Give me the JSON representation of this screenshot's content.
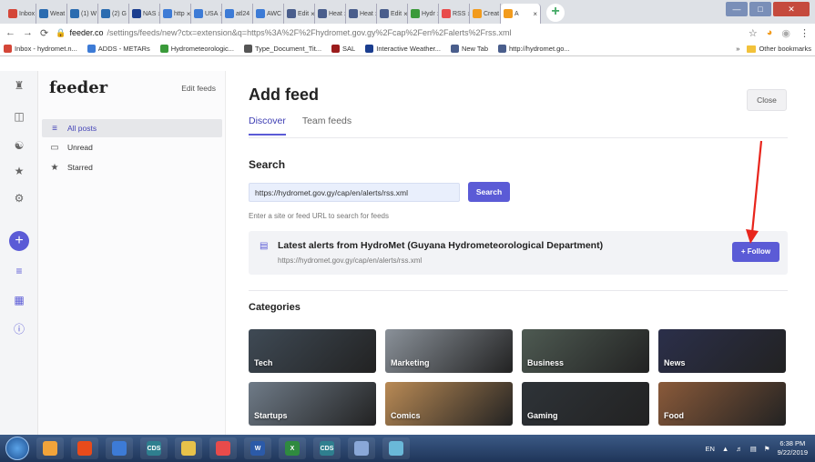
{
  "browser": {
    "tabs": [
      {
        "label": "Inbox",
        "color": "#d44638"
      },
      {
        "label": "Weat",
        "color": "#2b6cb0"
      },
      {
        "label": "(1) W",
        "color": "#2b6cb0"
      },
      {
        "label": "(2) G",
        "color": "#2b6cb0"
      },
      {
        "label": "NAS",
        "color": "#1a3d8f"
      },
      {
        "label": "http",
        "color": "#3d7bd6"
      },
      {
        "label": "USA",
        "color": "#3d7bd6"
      },
      {
        "label": "atl24",
        "color": "#3d7bd6"
      },
      {
        "label": "AWC",
        "color": "#3d7bd6"
      },
      {
        "label": "Edit",
        "color": "#4a5e8c"
      },
      {
        "label": "Heat",
        "color": "#4a5e8c"
      },
      {
        "label": "Heat",
        "color": "#4a5e8c"
      },
      {
        "label": "Edit",
        "color": "#4a5e8c"
      },
      {
        "label": "Hydr",
        "color": "#3a9a3a"
      },
      {
        "label": "RSS",
        "color": "#e84b4b"
      },
      {
        "label": "Creat",
        "color": "#f29b1d"
      },
      {
        "label": "A",
        "color": "#f29b1d"
      }
    ],
    "new_tab_symbol": "+",
    "url_host": "feeder.co",
    "url_rest": "/settings/feeds/new?ctx=extension&q=https%3A%2F%2Fhydromet.gov.gy%2Fcap%2Fen%2Falerts%2Frss.xml",
    "bookmarks": [
      {
        "label": "Inbox - hydromet.n...",
        "color": "#d44638"
      },
      {
        "label": "ADDS - METARs",
        "color": "#3d7bd6"
      },
      {
        "label": "Hydrometeorologic...",
        "color": "#3a9a3a"
      },
      {
        "label": "Type_Document_Tit...",
        "color": "#555555"
      },
      {
        "label": "SAL",
        "color": "#9b1c1c"
      },
      {
        "label": "Interactive Weather...",
        "color": "#1a3d8f"
      },
      {
        "label": "New Tab",
        "color": "#4a5e8c"
      },
      {
        "label": "http://hydromet.go...",
        "color": "#4a5e8c"
      }
    ],
    "overflow_symbol": "»",
    "other_bookmarks": "Other bookmarks"
  },
  "sidebar": {
    "logo": "feeder",
    "edit_feeds": "Edit feeds",
    "items": [
      {
        "label": "All posts",
        "icon": "list-icon"
      },
      {
        "label": "Unread",
        "icon": "inbox-icon"
      },
      {
        "label": "Starred",
        "icon": "star-icon"
      }
    ]
  },
  "main": {
    "title": "Add feed",
    "close_label": "Close",
    "tabs": [
      "Discover",
      "Team feeds"
    ],
    "search_heading": "Search",
    "search_value": "https://hydromet.gov.gy/cap/en/alerts/rss.xml",
    "search_button": "Search",
    "search_hint": "Enter a site or feed URL to search for feeds",
    "result": {
      "title": "Latest alerts from HydroMet (Guyana Hydrometeorological Department)",
      "url": "https://hydromet.gov.gy/cap/en/alerts/rss.xml",
      "follow_label": "+ Follow"
    },
    "categories_heading": "Categories",
    "categories": [
      {
        "label": "Tech",
        "color": "#3f4a55"
      },
      {
        "label": "Marketing",
        "color": "#8a9199"
      },
      {
        "label": "Business",
        "color": "#4e5a52"
      },
      {
        "label": "News",
        "color": "#2b2f4a"
      },
      {
        "label": "Startups",
        "color": "#6f7b88"
      },
      {
        "label": "Comics",
        "color": "#b98a55"
      },
      {
        "label": "Gaming",
        "color": "#2e3338"
      },
      {
        "label": "Food",
        "color": "#8a5a3a"
      }
    ]
  },
  "taskbar": {
    "language": "EN",
    "time": "6:38 PM",
    "date": "9/22/2019",
    "apps": [
      {
        "label": "",
        "color": "#f2a43a"
      },
      {
        "label": "",
        "color": "#e84b1b"
      },
      {
        "label": "",
        "color": "#3d7bd6"
      },
      {
        "label": "CDS",
        "color": "#2f7f8f"
      },
      {
        "label": "",
        "color": "#e8c24a"
      },
      {
        "label": "",
        "color": "#e84b4b"
      },
      {
        "label": "W",
        "color": "#2b5aa8"
      },
      {
        "label": "X",
        "color": "#2f8a3f"
      },
      {
        "label": "CDS",
        "color": "#2f7f8f"
      },
      {
        "label": "",
        "color": "#8aa8d8"
      },
      {
        "label": "",
        "color": "#6ab8d8"
      }
    ]
  },
  "accent_color": "#5b5bd6",
  "annotation_color": "#e8251c"
}
